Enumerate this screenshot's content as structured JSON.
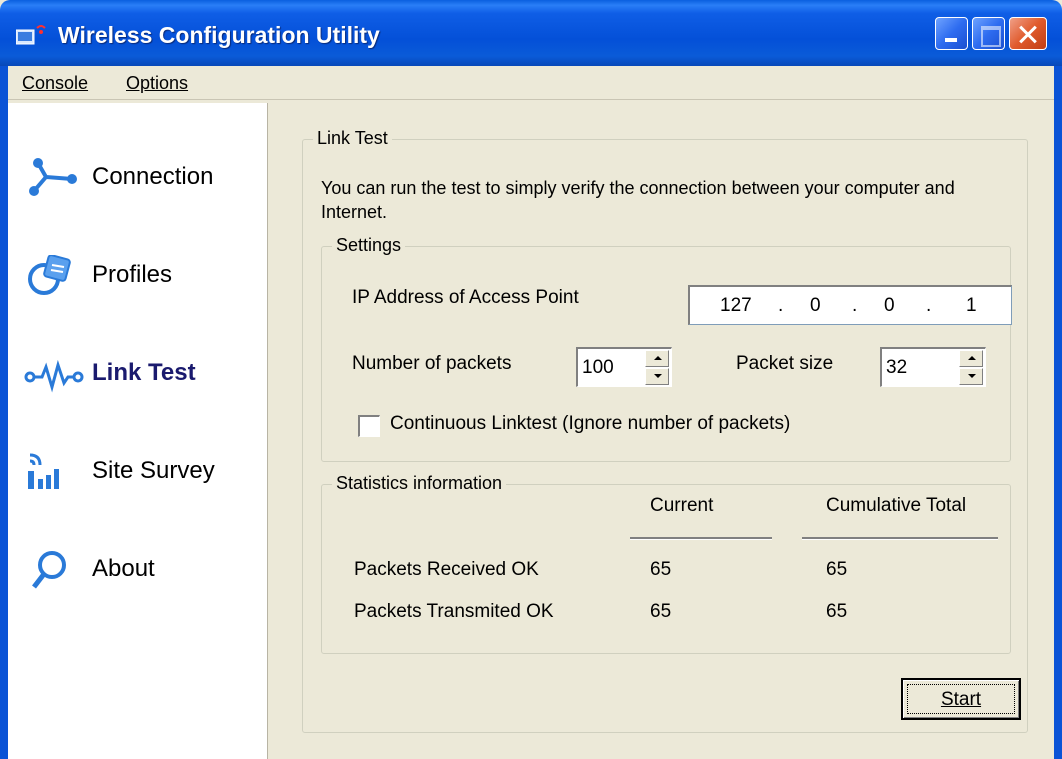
{
  "window": {
    "title": "Wireless Configuration Utility",
    "app_icon": "wireless-app-icon"
  },
  "menu": {
    "items": [
      {
        "label": "Console"
      },
      {
        "label": "Options"
      }
    ]
  },
  "sidebar": {
    "items": [
      {
        "label": "Connection",
        "icon": "connection-icon",
        "active": false
      },
      {
        "label": "Profiles",
        "icon": "profiles-icon",
        "active": false
      },
      {
        "label": "Link Test",
        "icon": "link-test-icon",
        "active": true
      },
      {
        "label": "Site Survey",
        "icon": "site-survey-icon",
        "active": false
      },
      {
        "label": "About",
        "icon": "about-icon",
        "active": false
      }
    ]
  },
  "linktest": {
    "group_title": "Link Test",
    "description": "You can run the test to simply verify the connection between your computer and Internet.",
    "settings": {
      "group_title": "Settings",
      "ip_label": "IP Address of Access Point",
      "ip_octets": [
        "127",
        "0",
        "0",
        "1"
      ],
      "ip_dot": ".",
      "packets_label": "Number of packets",
      "packets_value": "100",
      "size_label": "Packet size",
      "size_value": "32",
      "continuous_label": "Continuous Linktest (Ignore number of packets)",
      "continuous_checked": false
    },
    "stats": {
      "group_title": "Statistics information",
      "col_current": "Current",
      "col_total": "Cumulative Total",
      "rows": [
        {
          "label": "Packets Received OK",
          "current": "65",
          "total": "65"
        },
        {
          "label": "Packets Transmited OK",
          "current": "65",
          "total": "65"
        }
      ]
    },
    "start_label": "Start"
  },
  "colors": {
    "titlebar": "#0450d8",
    "window_bg": "#ece9d8",
    "active_nav": "#1a1a6e",
    "icon_blue": "#2a7ad8"
  }
}
